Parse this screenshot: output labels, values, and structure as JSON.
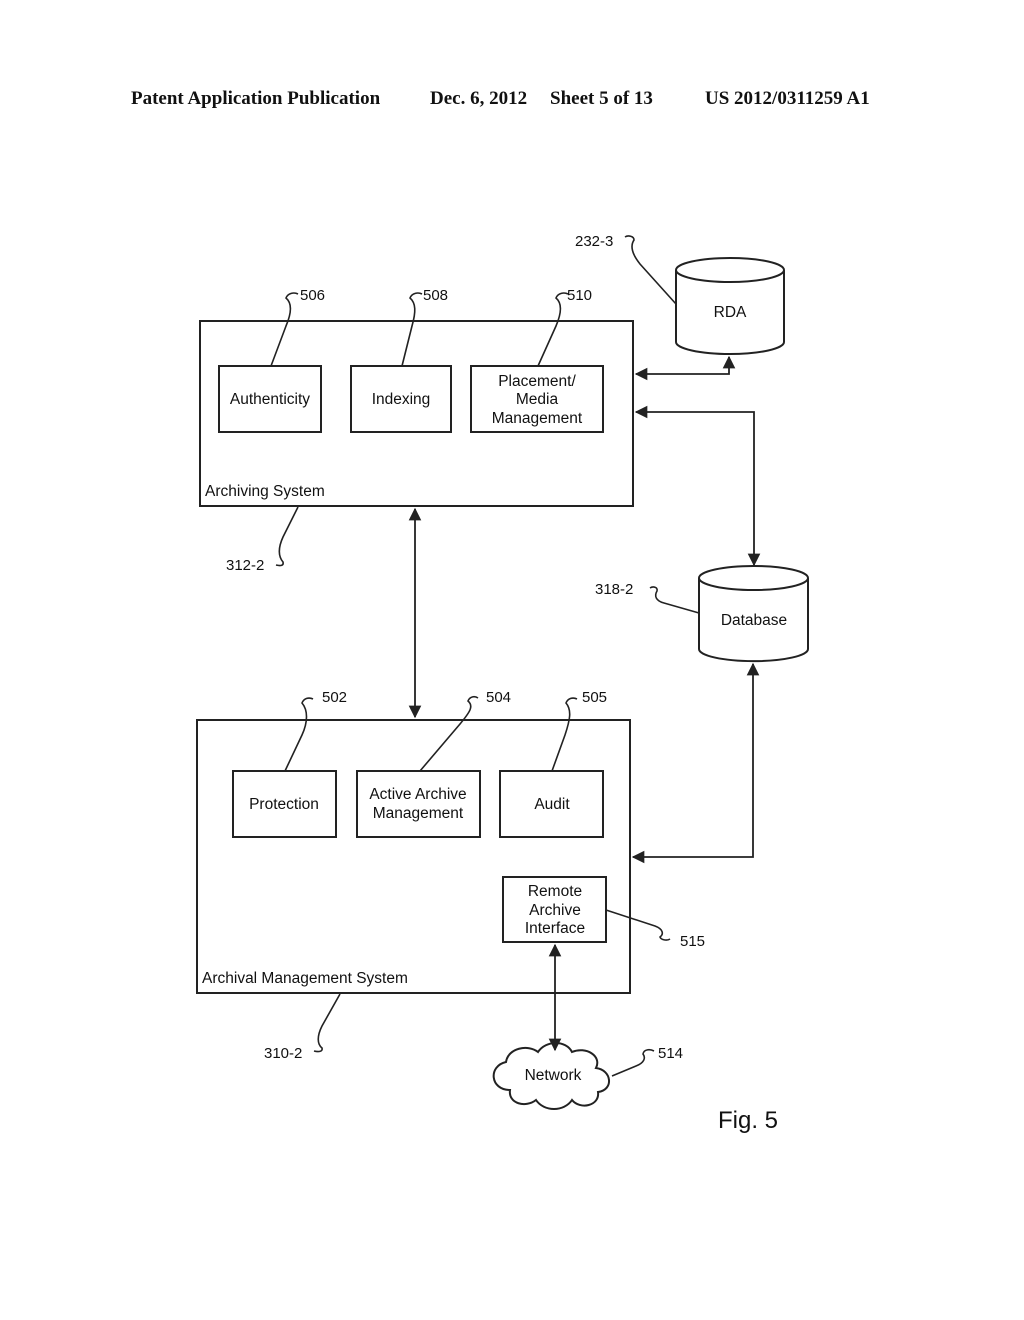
{
  "header": {
    "publication": "Patent Application Publication",
    "date": "Dec. 6, 2012",
    "sheet": "Sheet 5 of 13",
    "number": "US 2012/0311259 A1"
  },
  "figure_label": "Fig. 5",
  "archiving_system": {
    "label": "Archiving System",
    "ref": "312-2",
    "modules": [
      {
        "ref": "506",
        "lines": [
          "Authenticity"
        ]
      },
      {
        "ref": "508",
        "lines": [
          "Indexing"
        ]
      },
      {
        "ref": "510",
        "lines": [
          "Placement/",
          "Media",
          "Management"
        ]
      }
    ]
  },
  "archival_management_system": {
    "label": "Archival Management System",
    "ref": "310-2",
    "modules": [
      {
        "ref": "502",
        "lines": [
          "Protection"
        ]
      },
      {
        "ref": "504",
        "lines": [
          "Active Archive",
          "Management"
        ]
      },
      {
        "ref": "505",
        "lines": [
          "Audit"
        ]
      },
      {
        "ref": "515",
        "lines": [
          "Remote",
          "Archive",
          "Interface"
        ]
      }
    ]
  },
  "storage": {
    "rda": {
      "label": "RDA",
      "ref": "232-3"
    },
    "database": {
      "label": "Database",
      "ref": "318-2"
    }
  },
  "network": {
    "label": "Network",
    "ref": "514"
  }
}
